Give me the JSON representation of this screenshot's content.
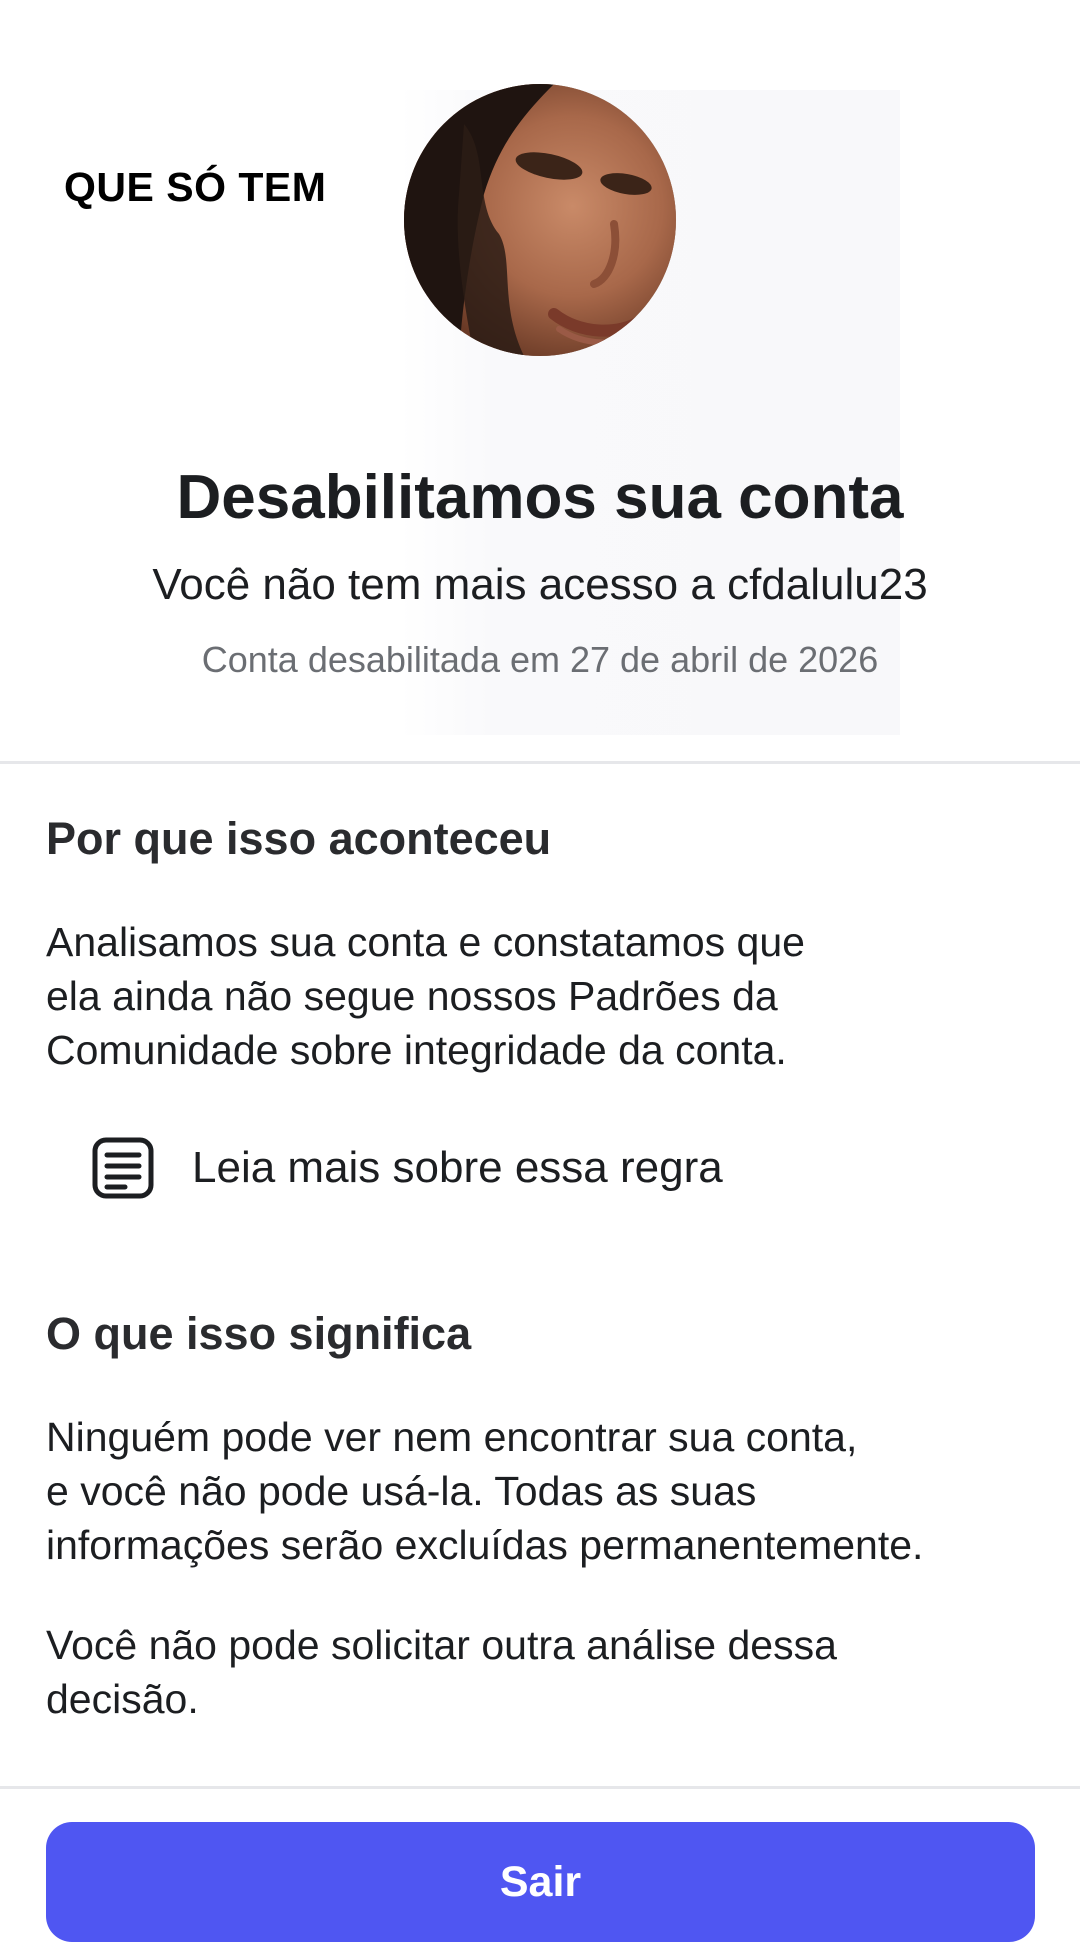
{
  "overlay": {
    "caption": "QUE SÓ TEM"
  },
  "profile": {
    "avatar_icon": "profile-photo"
  },
  "header": {
    "title": "Desabilitamos sua conta",
    "subtitle": "Você não tem mais acesso a cfdalulu23",
    "disabled_date": "Conta desabilitada em 27 de abril de 2026"
  },
  "why": {
    "heading": "Por que isso aconteceu",
    "body_lines": [
      "Analisamos sua conta e constatamos que",
      "ela ainda não segue nossos Padrões da",
      "Comunidade sobre integridade da conta."
    ],
    "link_label": "Leia mais sobre essa regra",
    "link_icon": "document-icon"
  },
  "meaning": {
    "heading": "O que isso significa",
    "body_lines": [
      "Ninguém pode ver nem encontrar sua conta,",
      "e você não pode usá-la. Todas as suas",
      "informações serão excluídas permanentemente."
    ],
    "review_lines": [
      "Você não pode solicitar outra análise dessa",
      "decisão."
    ]
  },
  "footer": {
    "exit_label": "Sair"
  },
  "colors": {
    "button": "#4f56f2",
    "text": "#1c1e21",
    "muted": "#6b6e73",
    "divider": "#e6e7ea"
  }
}
